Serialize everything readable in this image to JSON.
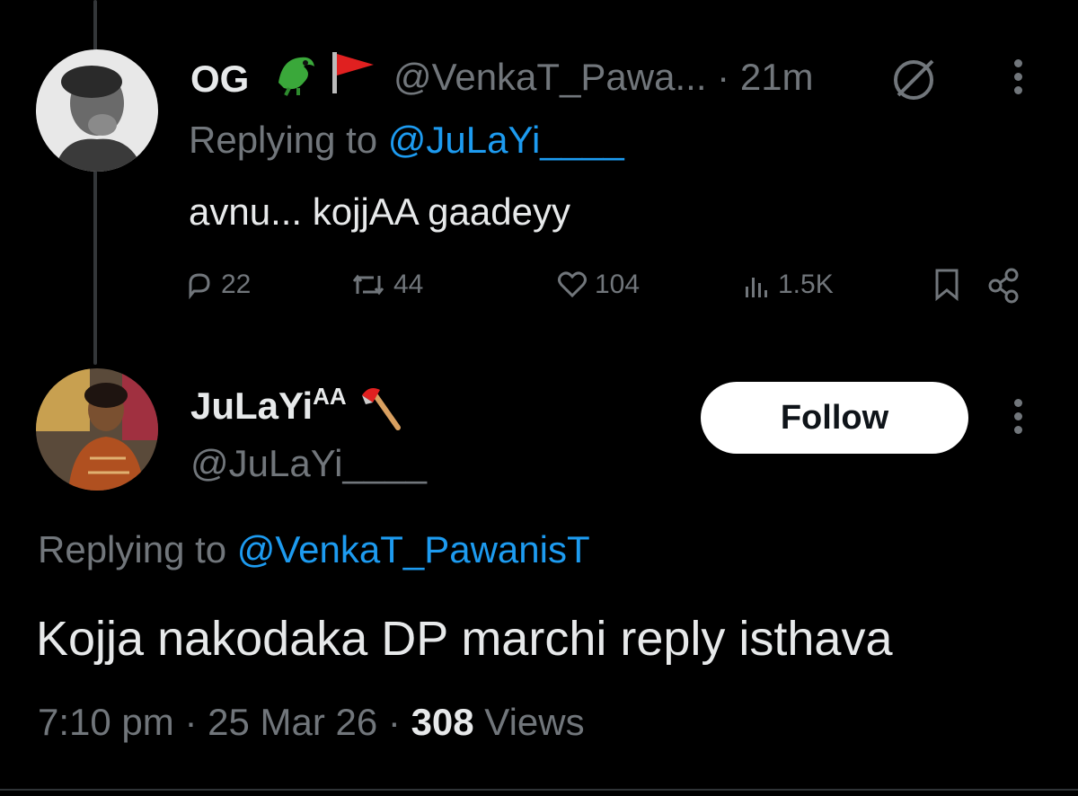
{
  "tweet1": {
    "author_name": "OG",
    "author_emoji": [
      "dragon-emoji",
      "red-flag-emoji"
    ],
    "handle": "@VenkaT_Pawa...",
    "separator": "·",
    "time": "21m",
    "replying_label": "Replying to ",
    "replying_handle": "@JuLaYi____",
    "text": "avnu... kojjAA gaadeyy",
    "stats": {
      "replies": "22",
      "retweets": "44",
      "likes": "104",
      "views": "1.5K"
    }
  },
  "tweet2": {
    "author_name": "JuLaYi",
    "author_name_sup": "AA",
    "author_emoji": "axe-emoji",
    "handle": "@JuLaYi____",
    "follow_label": "Follow",
    "replying_label": "Replying to ",
    "replying_handle": "@VenkaT_PawanisT",
    "text": "Kojja nakodaka DP marchi reply isthava",
    "time": "7:10 pm",
    "separator1": "·",
    "date": "25 Mar 26",
    "separator2": "·",
    "views_count": "308",
    "views_label": " Views"
  },
  "colors": {
    "background": "#000000",
    "primary_text": "#e7e9ea",
    "secondary_text": "#71767b",
    "link": "#1d9bf0",
    "follow_bg": "#ffffff"
  }
}
